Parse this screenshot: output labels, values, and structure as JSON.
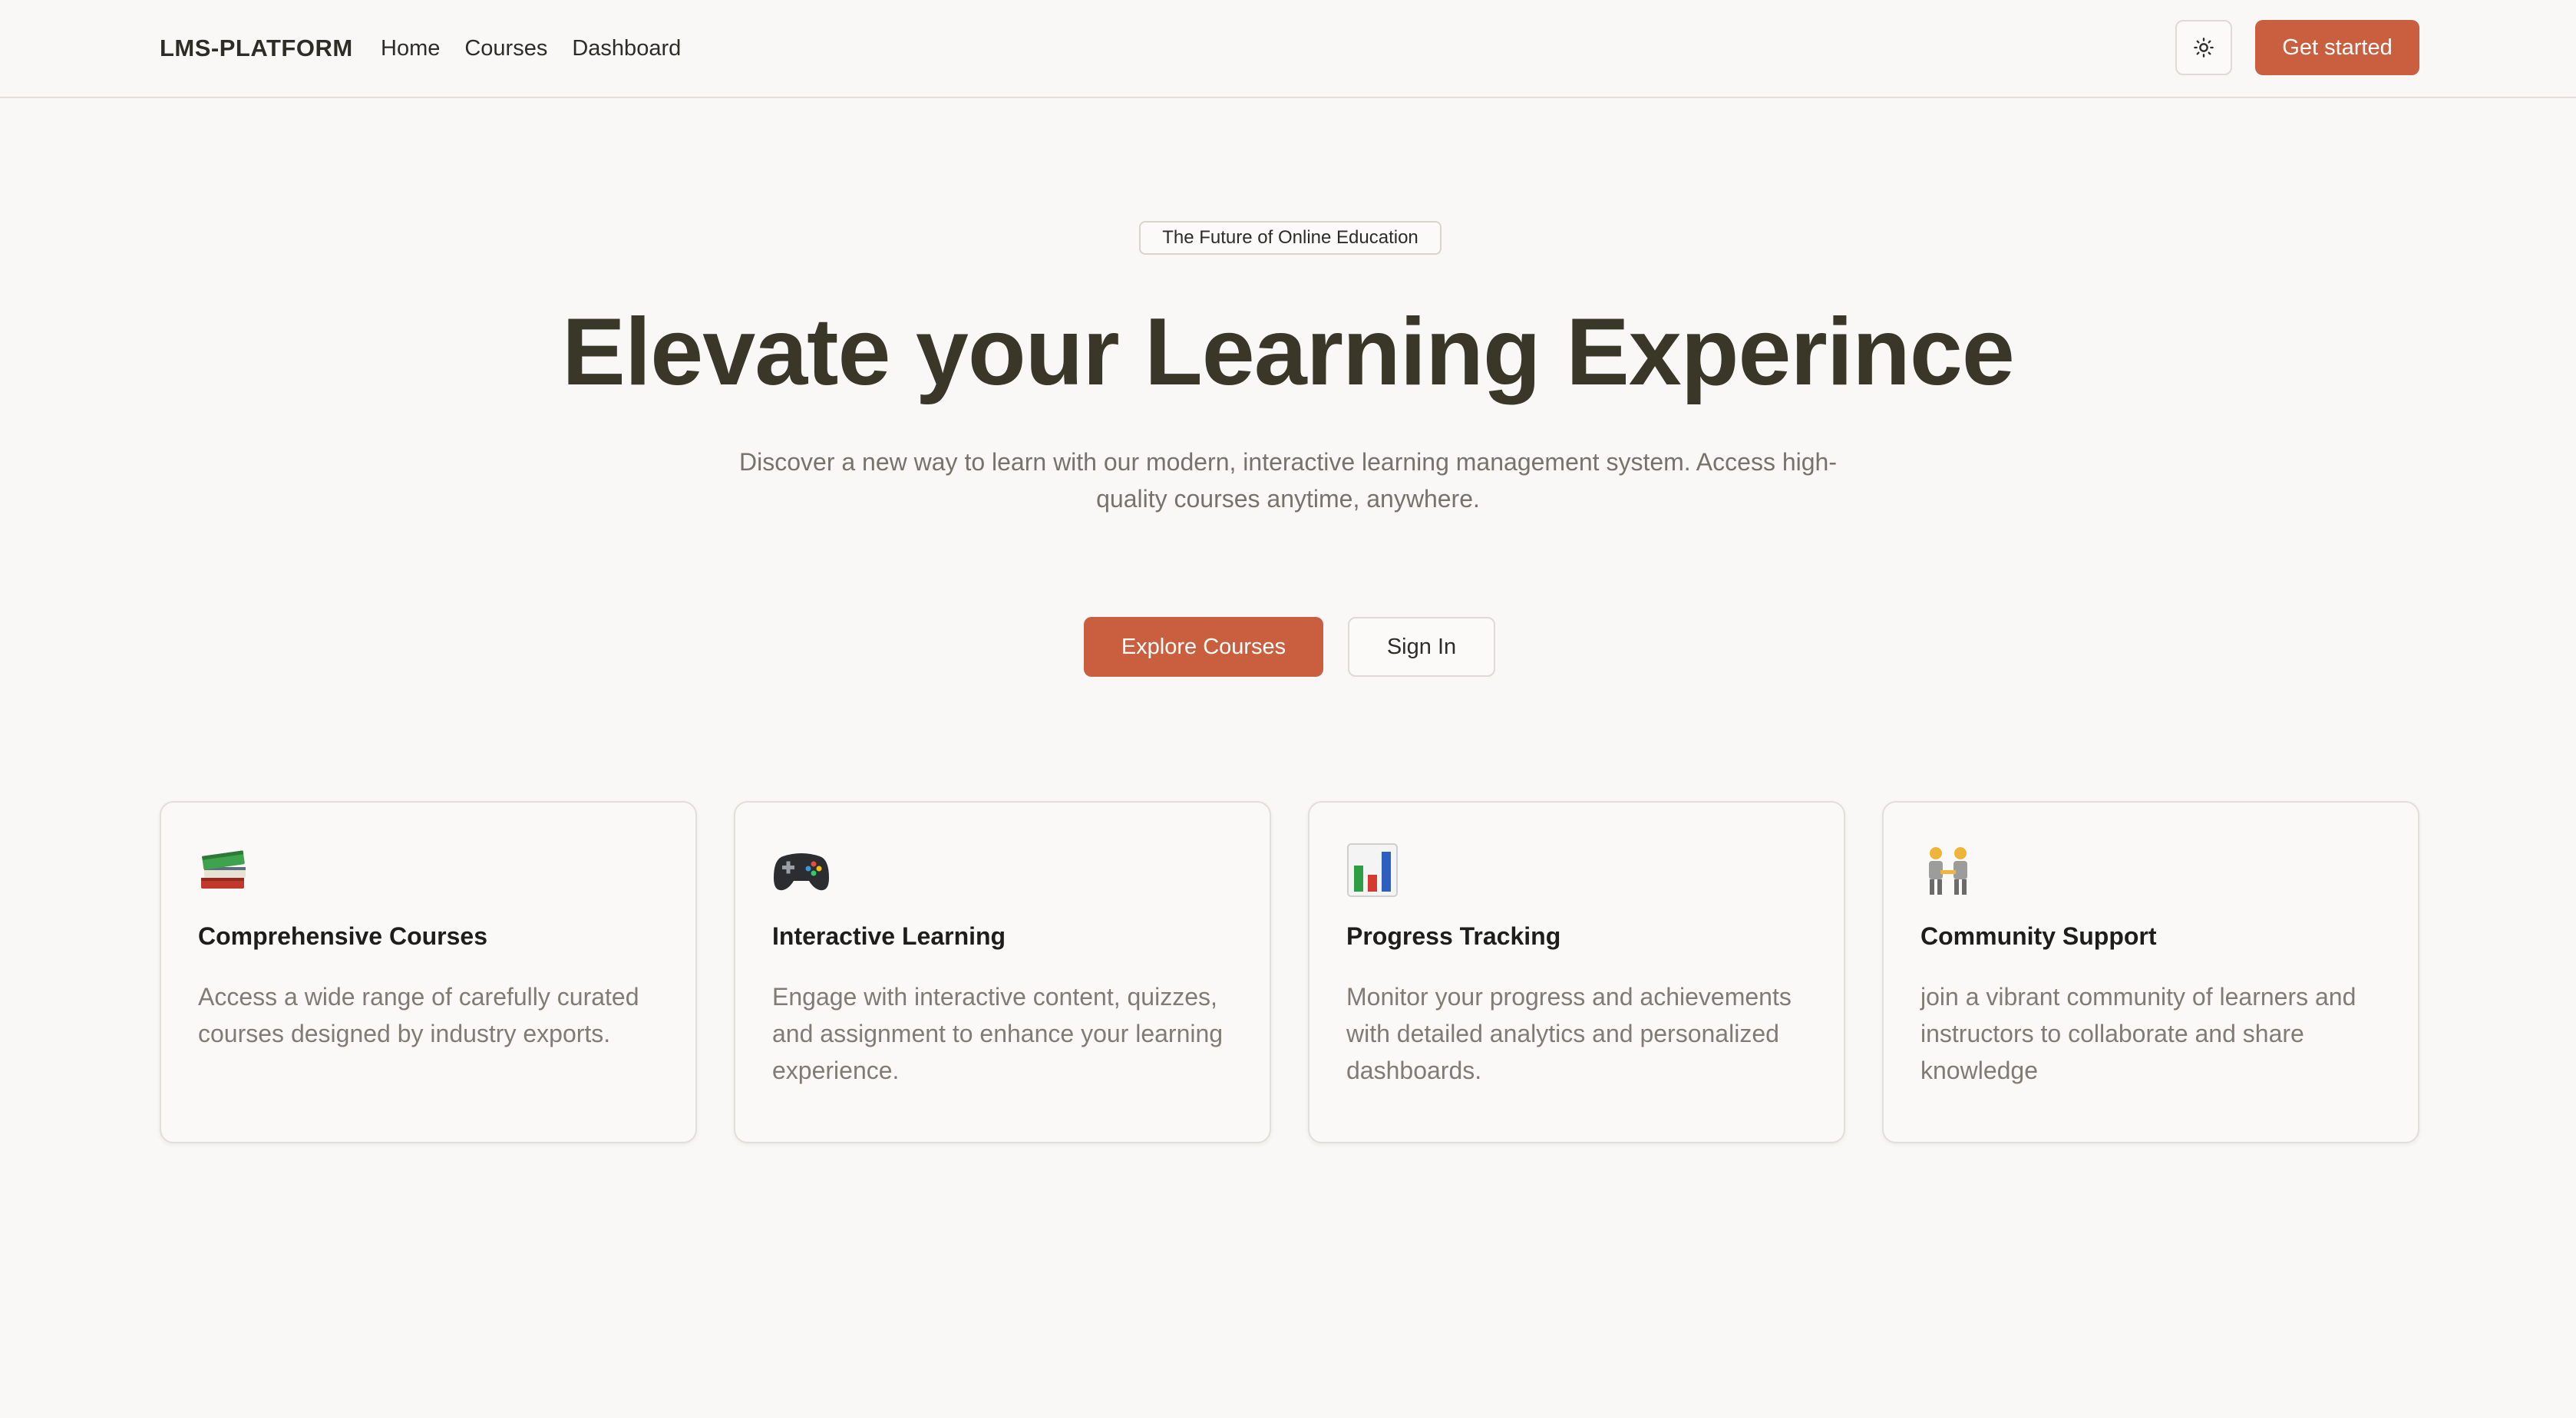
{
  "nav": {
    "brand": "LMS-PLATFORM",
    "links": [
      "Home",
      "Courses",
      "Dashboard"
    ],
    "theme_toggle_icon": "sun-icon",
    "cta_label": "Get started"
  },
  "hero": {
    "badge": "The Future of Online Education",
    "title": "Elevate your Learning Experince",
    "subtitle": "Discover a new way to learn with our modern, interactive learning management system. Access high-quality courses anytime, anywhere.",
    "primary_button": "Explore Courses",
    "secondary_button": "Sign In"
  },
  "features": [
    {
      "icon": "books-icon",
      "title": "Comprehensive Courses",
      "description": "Access a wide range of carefully curated courses designed by industry exports."
    },
    {
      "icon": "game-controller-icon",
      "title": "Interactive Learning",
      "description": "Engage with interactive content, quizzes, and assignment to enhance your learning experience."
    },
    {
      "icon": "bar-chart-icon",
      "title": "Progress Tracking",
      "description": "Monitor your progress and achievements with detailed analytics and personalized dashboards."
    },
    {
      "icon": "people-holding-hands-icon",
      "title": "Community Support",
      "description": "join a vibrant community of learners and instructors to collaborate and share knowledge"
    }
  ],
  "colors": {
    "accent": "#c95f3e",
    "background": "#f9f8f6",
    "title": "#3a3628",
    "muted_text": "#807b74"
  }
}
